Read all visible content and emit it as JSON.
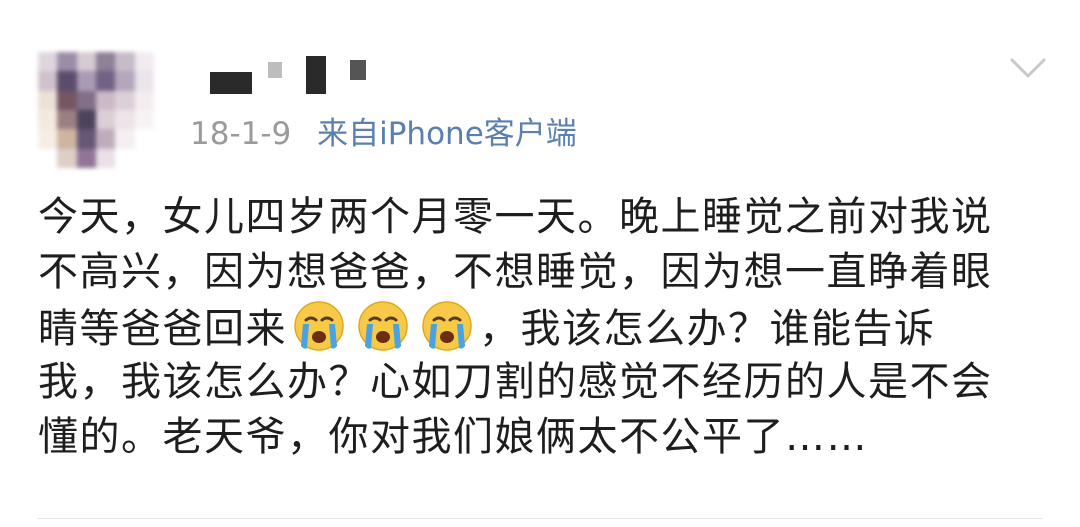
{
  "post": {
    "date": "18-1-9",
    "source": "来自iPhone客户端",
    "lines": [
      "今天，女儿四岁两个月零一天。晚上睡觉之前对我说",
      "不高兴，因为想爸爸，不想睡觉，因为想一直睁着眼",
      "睛等爸爸回来",
      "，我该怎么办？谁能告诉",
      "我，我该怎么办？心如刀割的感觉不经历的人是不会",
      "懂的。老天爷，你对我们娘俩太不公平了……"
    ],
    "emojis": [
      "crying-face-emoji",
      "crying-face-emoji",
      "crying-face-emoji"
    ]
  },
  "colors": {
    "text": "#1e1e1e",
    "meta": "#9a9a9a",
    "link": "#5a7fb0",
    "chevron": "#c8c8c8"
  },
  "icons": {
    "menu": "chevron-down-icon"
  }
}
